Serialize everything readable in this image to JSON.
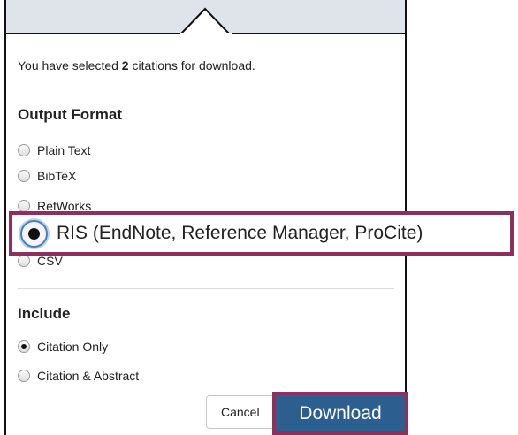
{
  "dialog": {
    "summary_prefix": "You have selected ",
    "selected_count": "2",
    "summary_suffix": " citations for download."
  },
  "output_format": {
    "title": "Output Format",
    "options": [
      {
        "label": "Plain Text",
        "selected": false
      },
      {
        "label": "BibTeX",
        "selected": false
      },
      {
        "label": "RefWorks",
        "selected": false
      },
      {
        "label": "RIS (EndNote, Reference Manager, ProCite)",
        "selected": true
      },
      {
        "label": "CSV",
        "selected": false
      }
    ]
  },
  "include": {
    "title": "Include",
    "options": [
      {
        "label": "Citation Only",
        "selected": true
      },
      {
        "label": "Citation & Abstract",
        "selected": false
      }
    ]
  },
  "buttons": {
    "cancel_label": "Cancel",
    "download_label": "Download"
  },
  "colors": {
    "highlight": "#8e2f5e",
    "download_button": "#2c5f8f",
    "header_band": "#dfe4ea"
  }
}
